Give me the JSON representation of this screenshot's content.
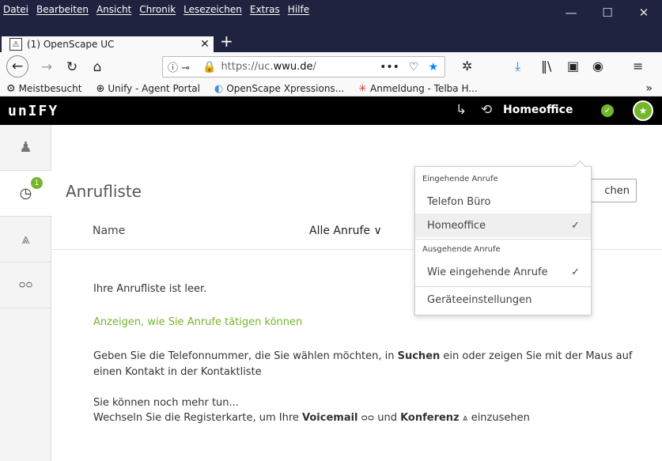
{
  "menubar": {
    "items": [
      "Datei",
      "Bearbeiten",
      "Ansicht",
      "Chronik",
      "Lesezeichen",
      "Extras",
      "Hilfe"
    ],
    "minimize": "—",
    "maximize": "☐",
    "close": "✕"
  },
  "tab": {
    "title": "(1) OpenScape UC",
    "close": "✕",
    "new_tab": "+"
  },
  "navbar": {
    "url_prefix": "https://uc.",
    "url_host": "wwu.de",
    "url_suffix": "/",
    "more": "•••"
  },
  "bookmarks": [
    {
      "icon": "⚙",
      "label": "Meistbesucht"
    },
    {
      "icon": "⊕",
      "label": "Unify - Agent Portal"
    },
    {
      "icon": "◐",
      "label": "OpenScape Xpressions..."
    },
    {
      "icon": "✳",
      "label": "Anmeldung - Telba H..."
    }
  ],
  "bookmarks_overflow": "»",
  "unify": {
    "logo": "unIFY",
    "presence_label": "Homeoffice",
    "sidebar_badge": "1"
  },
  "main": {
    "title": "Anrufliste",
    "search_button": "chen",
    "column_name": "Name",
    "filter": "Alle Anrufe",
    "empty": "Ihre Anrufliste ist leer.",
    "howto_link": "Anzeigen, wie Sie Anrufe tätigen können",
    "hint1_a": "Geben Sie die Telefonnummer, die Sie wählen möchten, in ",
    "hint1_b": "Suchen",
    "hint1_c": " ein oder zeigen Sie mit der Maus auf einen Kontakt in der Kontaktliste",
    "hint2_line1": "Sie können noch mehr tun...",
    "hint2_a": "Wechseln Sie die Registerkarte, um Ihre ",
    "hint2_voicemail": "Voicemail",
    "hint2_und": " und ",
    "hint2_konferenz": "Konferenz",
    "hint2_end": " einzusehen"
  },
  "dropdown": {
    "incoming_header": "Eingehende Anrufe",
    "incoming_options": [
      "Telefon Büro",
      "Homeoffice"
    ],
    "outgoing_header": "Ausgehende Anrufe",
    "outgoing_option": "Wie eingehende Anrufe",
    "settings": "Geräteeinstellungen",
    "check": "✓"
  }
}
